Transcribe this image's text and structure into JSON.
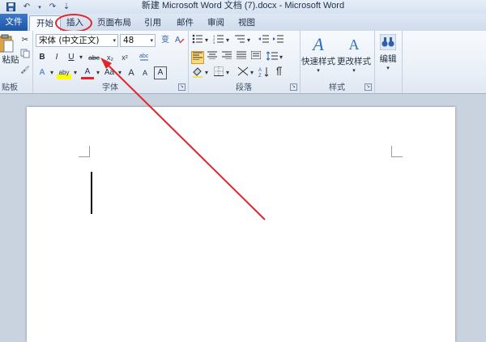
{
  "window": {
    "title": "新建 Microsoft Word 文档 (7).docx - Microsoft Word"
  },
  "qat": {
    "save_icon": "save-icon",
    "undo_glyph": "↶",
    "undo_dd": "▾",
    "redo_glyph": "↷",
    "customize_glyph": "⇣"
  },
  "tabs": [
    "文件",
    "开始",
    "插入",
    "页面布局",
    "引用",
    "邮件",
    "审阅",
    "视图"
  ],
  "ribbon": {
    "clipboard": {
      "label": "贴板",
      "paste_label": "粘贴",
      "cut": "✂",
      "format_painter": "🖌"
    },
    "font": {
      "label": "字体",
      "font_name": "宋体 (中文正文)",
      "font_size": "48",
      "wen": "变",
      "bold": "B",
      "italic": "I",
      "underline": "U",
      "strike": "abc",
      "sub": "x₂",
      "sup": "x²",
      "text_effect": "A",
      "highlight": "aby",
      "font_color": "A",
      "aa": "Aa",
      "grow": "A",
      "shrink": "A",
      "char_border": "A",
      "dropdown": "▾"
    },
    "paragraph": {
      "label": "段落"
    },
    "styles": {
      "label": "样式",
      "quick_styles": "快速样式",
      "change_styles": "更改样式"
    },
    "editing": {
      "label": "编辑"
    }
  },
  "colors": {
    "accent_red": "#e1262b",
    "file_tab": "#2a64b4"
  }
}
